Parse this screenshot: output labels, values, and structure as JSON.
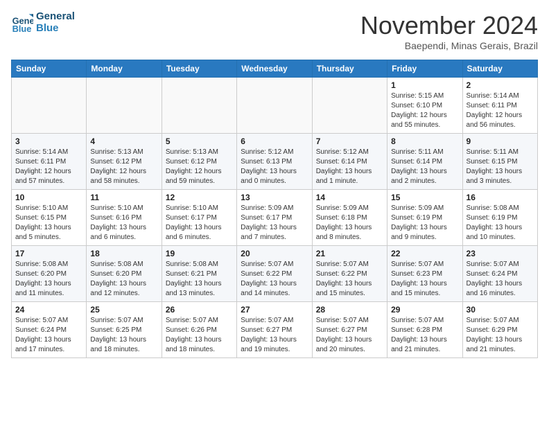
{
  "logo": {
    "line1": "General",
    "line2": "Blue"
  },
  "title": "November 2024",
  "subtitle": "Baependi, Minas Gerais, Brazil",
  "weekdays": [
    "Sunday",
    "Monday",
    "Tuesday",
    "Wednesday",
    "Thursday",
    "Friday",
    "Saturday"
  ],
  "weeks": [
    [
      {
        "day": "",
        "info": ""
      },
      {
        "day": "",
        "info": ""
      },
      {
        "day": "",
        "info": ""
      },
      {
        "day": "",
        "info": ""
      },
      {
        "day": "",
        "info": ""
      },
      {
        "day": "1",
        "info": "Sunrise: 5:15 AM\nSunset: 6:10 PM\nDaylight: 12 hours\nand 55 minutes."
      },
      {
        "day": "2",
        "info": "Sunrise: 5:14 AM\nSunset: 6:11 PM\nDaylight: 12 hours\nand 56 minutes."
      }
    ],
    [
      {
        "day": "3",
        "info": "Sunrise: 5:14 AM\nSunset: 6:11 PM\nDaylight: 12 hours\nand 57 minutes."
      },
      {
        "day": "4",
        "info": "Sunrise: 5:13 AM\nSunset: 6:12 PM\nDaylight: 12 hours\nand 58 minutes."
      },
      {
        "day": "5",
        "info": "Sunrise: 5:13 AM\nSunset: 6:12 PM\nDaylight: 12 hours\nand 59 minutes."
      },
      {
        "day": "6",
        "info": "Sunrise: 5:12 AM\nSunset: 6:13 PM\nDaylight: 13 hours\nand 0 minutes."
      },
      {
        "day": "7",
        "info": "Sunrise: 5:12 AM\nSunset: 6:14 PM\nDaylight: 13 hours\nand 1 minute."
      },
      {
        "day": "8",
        "info": "Sunrise: 5:11 AM\nSunset: 6:14 PM\nDaylight: 13 hours\nand 2 minutes."
      },
      {
        "day": "9",
        "info": "Sunrise: 5:11 AM\nSunset: 6:15 PM\nDaylight: 13 hours\nand 3 minutes."
      }
    ],
    [
      {
        "day": "10",
        "info": "Sunrise: 5:10 AM\nSunset: 6:15 PM\nDaylight: 13 hours\nand 5 minutes."
      },
      {
        "day": "11",
        "info": "Sunrise: 5:10 AM\nSunset: 6:16 PM\nDaylight: 13 hours\nand 6 minutes."
      },
      {
        "day": "12",
        "info": "Sunrise: 5:10 AM\nSunset: 6:17 PM\nDaylight: 13 hours\nand 6 minutes."
      },
      {
        "day": "13",
        "info": "Sunrise: 5:09 AM\nSunset: 6:17 PM\nDaylight: 13 hours\nand 7 minutes."
      },
      {
        "day": "14",
        "info": "Sunrise: 5:09 AM\nSunset: 6:18 PM\nDaylight: 13 hours\nand 8 minutes."
      },
      {
        "day": "15",
        "info": "Sunrise: 5:09 AM\nSunset: 6:19 PM\nDaylight: 13 hours\nand 9 minutes."
      },
      {
        "day": "16",
        "info": "Sunrise: 5:08 AM\nSunset: 6:19 PM\nDaylight: 13 hours\nand 10 minutes."
      }
    ],
    [
      {
        "day": "17",
        "info": "Sunrise: 5:08 AM\nSunset: 6:20 PM\nDaylight: 13 hours\nand 11 minutes."
      },
      {
        "day": "18",
        "info": "Sunrise: 5:08 AM\nSunset: 6:20 PM\nDaylight: 13 hours\nand 12 minutes."
      },
      {
        "day": "19",
        "info": "Sunrise: 5:08 AM\nSunset: 6:21 PM\nDaylight: 13 hours\nand 13 minutes."
      },
      {
        "day": "20",
        "info": "Sunrise: 5:07 AM\nSunset: 6:22 PM\nDaylight: 13 hours\nand 14 minutes."
      },
      {
        "day": "21",
        "info": "Sunrise: 5:07 AM\nSunset: 6:22 PM\nDaylight: 13 hours\nand 15 minutes."
      },
      {
        "day": "22",
        "info": "Sunrise: 5:07 AM\nSunset: 6:23 PM\nDaylight: 13 hours\nand 15 minutes."
      },
      {
        "day": "23",
        "info": "Sunrise: 5:07 AM\nSunset: 6:24 PM\nDaylight: 13 hours\nand 16 minutes."
      }
    ],
    [
      {
        "day": "24",
        "info": "Sunrise: 5:07 AM\nSunset: 6:24 PM\nDaylight: 13 hours\nand 17 minutes."
      },
      {
        "day": "25",
        "info": "Sunrise: 5:07 AM\nSunset: 6:25 PM\nDaylight: 13 hours\nand 18 minutes."
      },
      {
        "day": "26",
        "info": "Sunrise: 5:07 AM\nSunset: 6:26 PM\nDaylight: 13 hours\nand 18 minutes."
      },
      {
        "day": "27",
        "info": "Sunrise: 5:07 AM\nSunset: 6:27 PM\nDaylight: 13 hours\nand 19 minutes."
      },
      {
        "day": "28",
        "info": "Sunrise: 5:07 AM\nSunset: 6:27 PM\nDaylight: 13 hours\nand 20 minutes."
      },
      {
        "day": "29",
        "info": "Sunrise: 5:07 AM\nSunset: 6:28 PM\nDaylight: 13 hours\nand 21 minutes."
      },
      {
        "day": "30",
        "info": "Sunrise: 5:07 AM\nSunset: 6:29 PM\nDaylight: 13 hours\nand 21 minutes."
      }
    ]
  ]
}
